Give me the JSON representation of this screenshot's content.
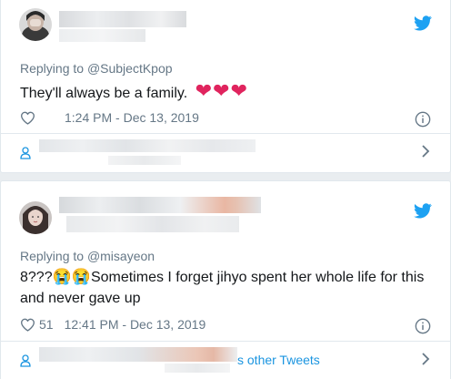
{
  "tweets": [
    {
      "reply_prefix": "Replying to",
      "reply_handle": "@SubjectKpop",
      "text": "They'll always be a family.",
      "emoji": "❤❤❤",
      "like_count": "",
      "timestamp": "1:24 PM - Dec 13, 2019",
      "conversation_link": ""
    },
    {
      "reply_prefix": "Replying to",
      "reply_handle": "@misayeon",
      "text_line1_a": "8???",
      "text_line1_emoji": "😭😭",
      "text_line1_b": "Sometimes I forget jihyo spent her whole life for this",
      "text_line2": "and never gave up",
      "like_count": "51",
      "timestamp": "12:41 PM - Dec 13, 2019",
      "conversation_link": "s other Tweets"
    }
  ],
  "icons": {
    "bird": "twitter-bird-icon",
    "heart": "heart-outline-icon",
    "info": "info-icon",
    "person": "person-icon",
    "chevron": "chevron-right-icon"
  },
  "colors": {
    "brand": "#1da1f2",
    "link": "#1b95e0",
    "muted": "#657786",
    "heart_red": "#e0245e"
  }
}
